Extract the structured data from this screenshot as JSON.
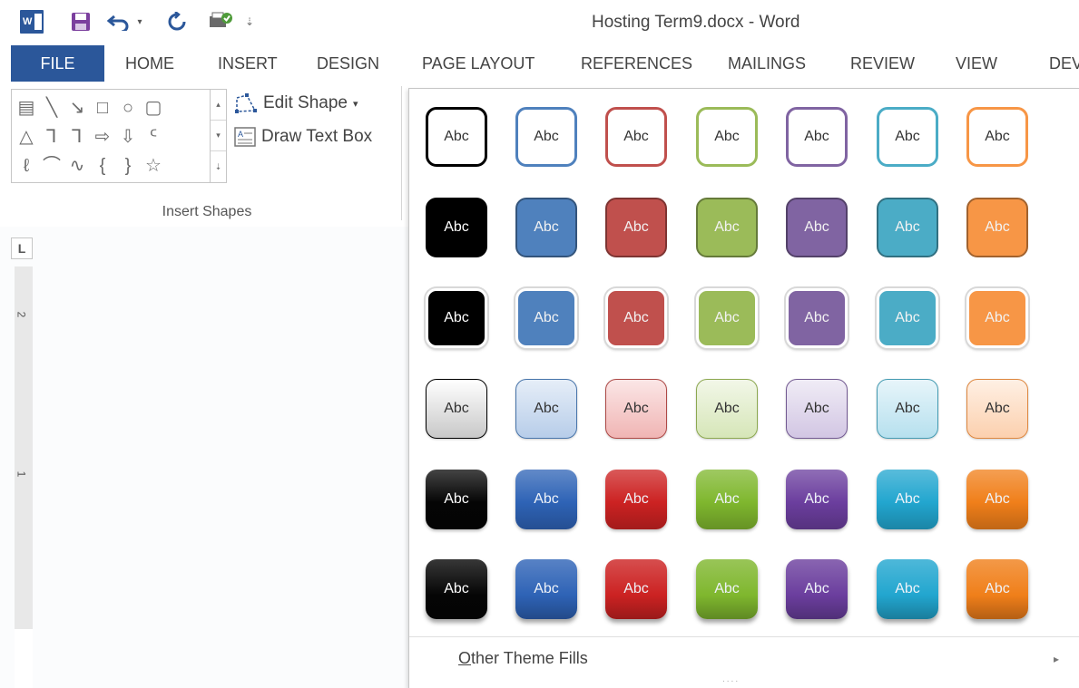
{
  "window": {
    "title": "Hosting Term9.docx - Word"
  },
  "qat": {
    "redo_glyph": "↺",
    "more_glyph": "⇣",
    "undo_glyph": "↶",
    "dropdown_glyph": "▾"
  },
  "tabs": [
    {
      "label": "FILE",
      "active": true
    },
    {
      "label": "HOME"
    },
    {
      "label": "INSERT"
    },
    {
      "label": "DESIGN"
    },
    {
      "label": "PAGE LAYOUT"
    },
    {
      "label": "REFERENCES"
    },
    {
      "label": "MAILINGS"
    },
    {
      "label": "REVIEW"
    },
    {
      "label": "VIEW"
    },
    {
      "label": "DEV"
    }
  ],
  "ribbon": {
    "edit_shape_label": "Edit Shape",
    "edit_shape_arrow": "▾",
    "draw_text_box_label": "Draw Text Box",
    "group_label": "Insert Shapes",
    "shape_rows": [
      [
        "▤",
        "╲",
        "↘",
        "□",
        "○",
        "▢"
      ],
      [
        "△",
        "⅂",
        "⅂",
        "⇨",
        "⇩",
        "ᑦ"
      ],
      [
        "ℓ",
        "⌒",
        "∿",
        "{",
        "}",
        "☆"
      ]
    ]
  },
  "ruler": {
    "corner_label": "L",
    "numbers": [
      "2",
      "1"
    ]
  },
  "gallery": {
    "swatch_text": "Abc",
    "other_fills_underlined": "O",
    "other_fills_rest": "ther Theme Fills",
    "other_fills_arrow": "▸",
    "grip": "....",
    "colors": [
      {
        "name": "black",
        "base": "#000000",
        "light": "#c8c8c8",
        "pale": "#ffffff"
      },
      {
        "name": "blue",
        "base": "#4f81bd",
        "light": "#b7cde9",
        "pale": "#e6eef8"
      },
      {
        "name": "red",
        "base": "#c0504d",
        "light": "#f0b5b4",
        "pale": "#fbe6e6"
      },
      {
        "name": "green",
        "base": "#9bbb59",
        "light": "#d6e6b8",
        "pale": "#f2f7e8"
      },
      {
        "name": "purple",
        "base": "#8064a2",
        "light": "#d2c6e3",
        "pale": "#f0ecf6"
      },
      {
        "name": "aqua",
        "base": "#4bacc6",
        "light": "#b6e0ee",
        "pale": "#e7f5fa"
      },
      {
        "name": "orange",
        "base": "#f79646",
        "light": "#fcd0ae",
        "pale": "#fef0e4"
      }
    ],
    "vivid": {
      "black": "#050505",
      "blue": "#2e63b6",
      "red": "#cc2222",
      "green": "#7fb72e",
      "purple": "#6b3e9e",
      "aqua": "#22a6cf",
      "orange": "#f07f1a"
    }
  }
}
